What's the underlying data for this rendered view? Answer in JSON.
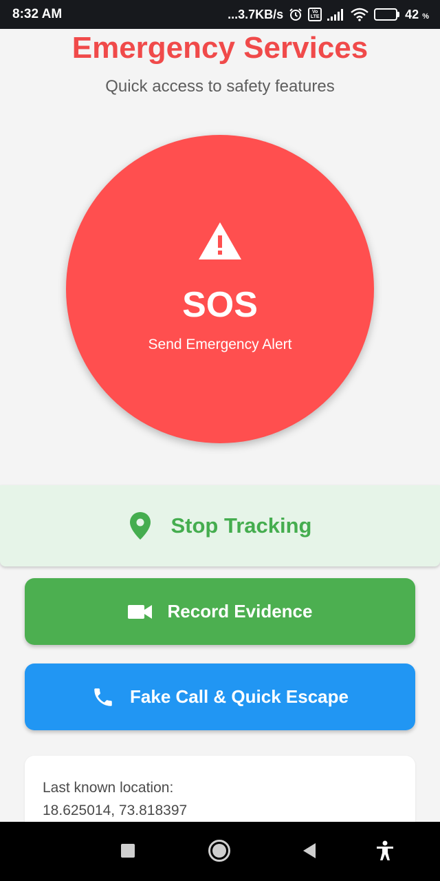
{
  "status_bar": {
    "time": "8:32 AM",
    "network_speed": "...3.7KB/s",
    "volte_top": "Vo",
    "volte_bottom": "LTE",
    "battery_percent": "42",
    "battery_unit": "%",
    "battery_level": 0.42,
    "icons": [
      "alarm-icon",
      "volte-icon",
      "signal-icon",
      "wifi-icon",
      "battery-icon"
    ]
  },
  "header": {
    "title": "Emergency Services",
    "subtitle": "Quick access to safety features"
  },
  "sos": {
    "label": "SOS",
    "sublabel": "Send Emergency Alert",
    "icon": "warning-icon"
  },
  "tracking": {
    "label": "Stop Tracking",
    "icon": "location-pin-icon"
  },
  "actions": {
    "record_label": "Record Evidence",
    "record_icon": "videocam-icon",
    "fake_call_label": "Fake Call & Quick Escape",
    "fake_call_icon": "phone-icon"
  },
  "location": {
    "label": "Last known location:",
    "coordinates": "18.625014, 73.818397"
  },
  "nav_bar": {
    "icons": [
      "recents-icon",
      "home-icon",
      "back-icon",
      "accessibility-icon"
    ]
  },
  "colors": {
    "accent_red": "#ff4f4f",
    "title_red": "#f04a4a",
    "tracking_green": "#45ad4f",
    "tracking_bg": "#e6f4e8",
    "record_green": "#4caf50",
    "call_blue": "#2196f3",
    "background": "#f4f4f4"
  }
}
